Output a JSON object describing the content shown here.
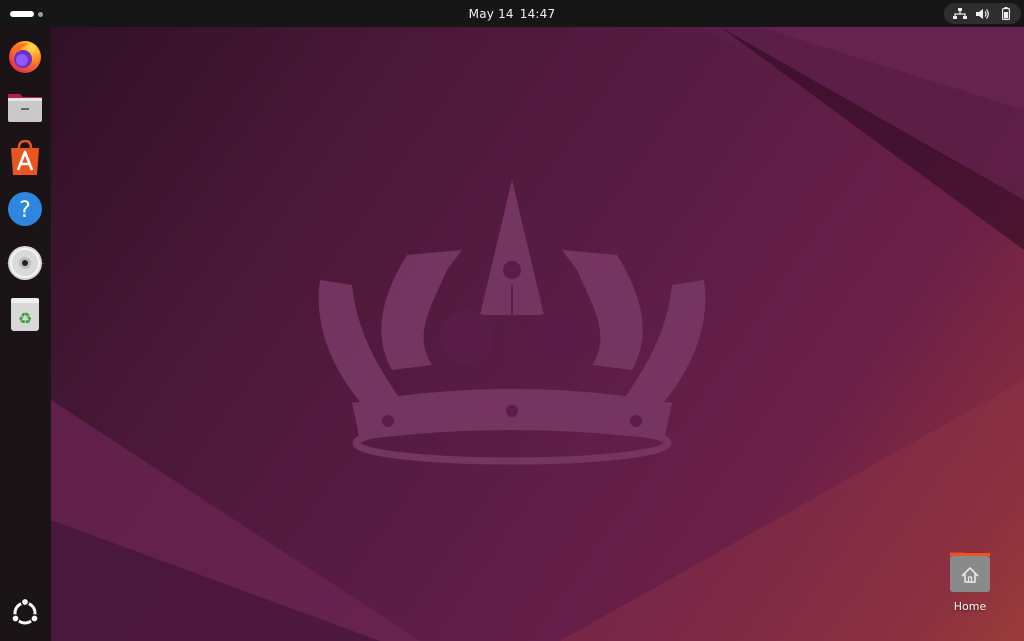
{
  "topbar": {
    "date": "May 14",
    "time": "14:47",
    "tray_icons": [
      "network-icon",
      "volume-icon",
      "battery-icon"
    ]
  },
  "dock": {
    "apps": [
      {
        "name": "firefox",
        "icon": "firefox-icon"
      },
      {
        "name": "files",
        "icon": "files-icon"
      },
      {
        "name": "app-center",
        "icon": "app-center-icon"
      },
      {
        "name": "help",
        "icon": "help-icon"
      },
      {
        "name": "disc",
        "icon": "disc-icon"
      },
      {
        "name": "trash",
        "icon": "trash-icon"
      }
    ],
    "show_apps_icon": "ubuntu-logo-icon"
  },
  "desktop": {
    "icons": [
      {
        "label": "Home",
        "icon": "home-folder-icon"
      }
    ]
  },
  "colors": {
    "wallpaper_dark": "#2c0f22",
    "wallpaper_mid": "#5b1d45",
    "wallpaper_warm": "#a6432f",
    "topbar_bg": "#161616",
    "dock_bg": "#1b1416"
  }
}
